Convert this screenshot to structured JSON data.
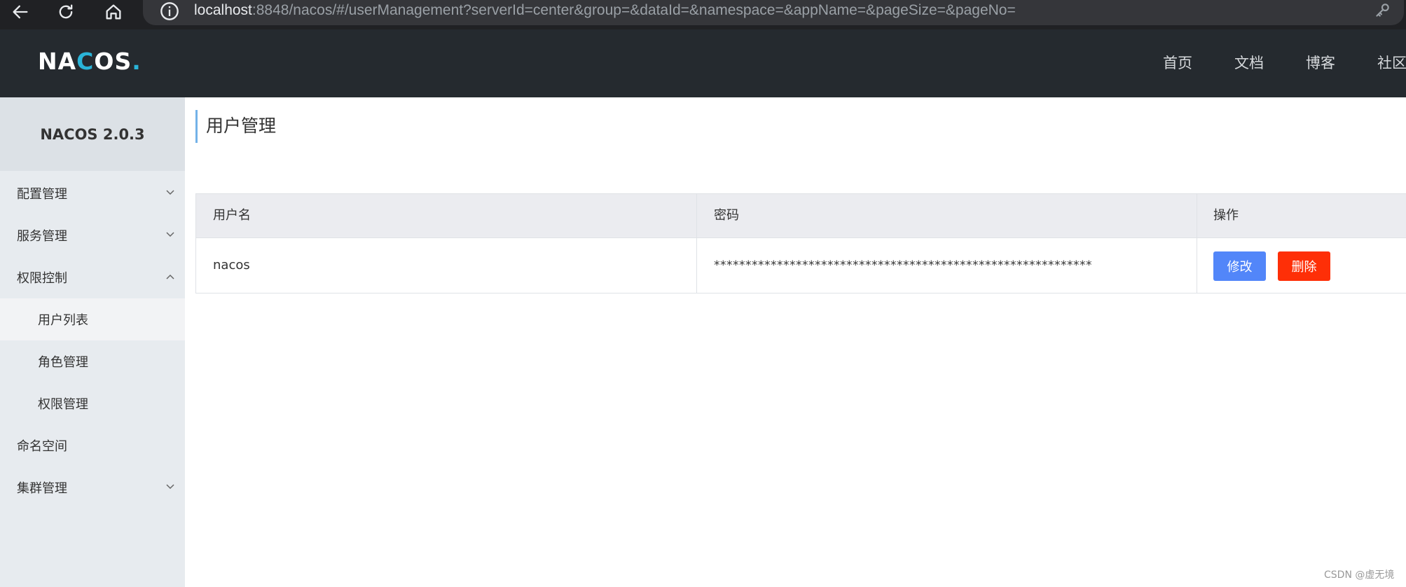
{
  "browser": {
    "url_host": "localhost",
    "url_rest": ":8848/nacos/#/userManagement?serverId=center&group=&dataId=&namespace=&appName=&pageSize=&pageNo=",
    "icons": [
      "back-arrow-icon",
      "reload-icon",
      "home-icon",
      "info-icon",
      "key-icon"
    ]
  },
  "header": {
    "logo": {
      "part1": "NA",
      "part2": "C",
      "part3": "OS",
      "dot": "."
    },
    "nav": [
      "首页",
      "文档",
      "博客",
      "社区"
    ]
  },
  "sidebar": {
    "title": "NACOS 2.0.3",
    "items": [
      {
        "label": "配置管理",
        "expandable": true,
        "expanded": false
      },
      {
        "label": "服务管理",
        "expandable": true,
        "expanded": false
      },
      {
        "label": "权限控制",
        "expandable": true,
        "expanded": true
      },
      {
        "label": "用户列表",
        "sub": true,
        "active": true
      },
      {
        "label": "角色管理",
        "sub": true
      },
      {
        "label": "权限管理",
        "sub": true
      },
      {
        "label": "命名空间",
        "expandable": false
      },
      {
        "label": "集群管理",
        "expandable": true,
        "expanded": false
      }
    ]
  },
  "main": {
    "title": "用户管理",
    "table": {
      "headers": [
        "用户名",
        "密码",
        "操作"
      ],
      "rows": [
        {
          "username": "nacos",
          "password": "************************************************************",
          "actions": {
            "edit": "修改",
            "delete": "删除"
          }
        }
      ]
    }
  },
  "watermark": "CSDN @虚无境",
  "colors": {
    "header_bg": "#252a2f",
    "sidebar_bg": "#e7ebef",
    "accent": "#73b2e8",
    "edit_button": "#5286f9",
    "delete_button": "#fe2f07",
    "logo_accent": "#2ab4d8"
  }
}
